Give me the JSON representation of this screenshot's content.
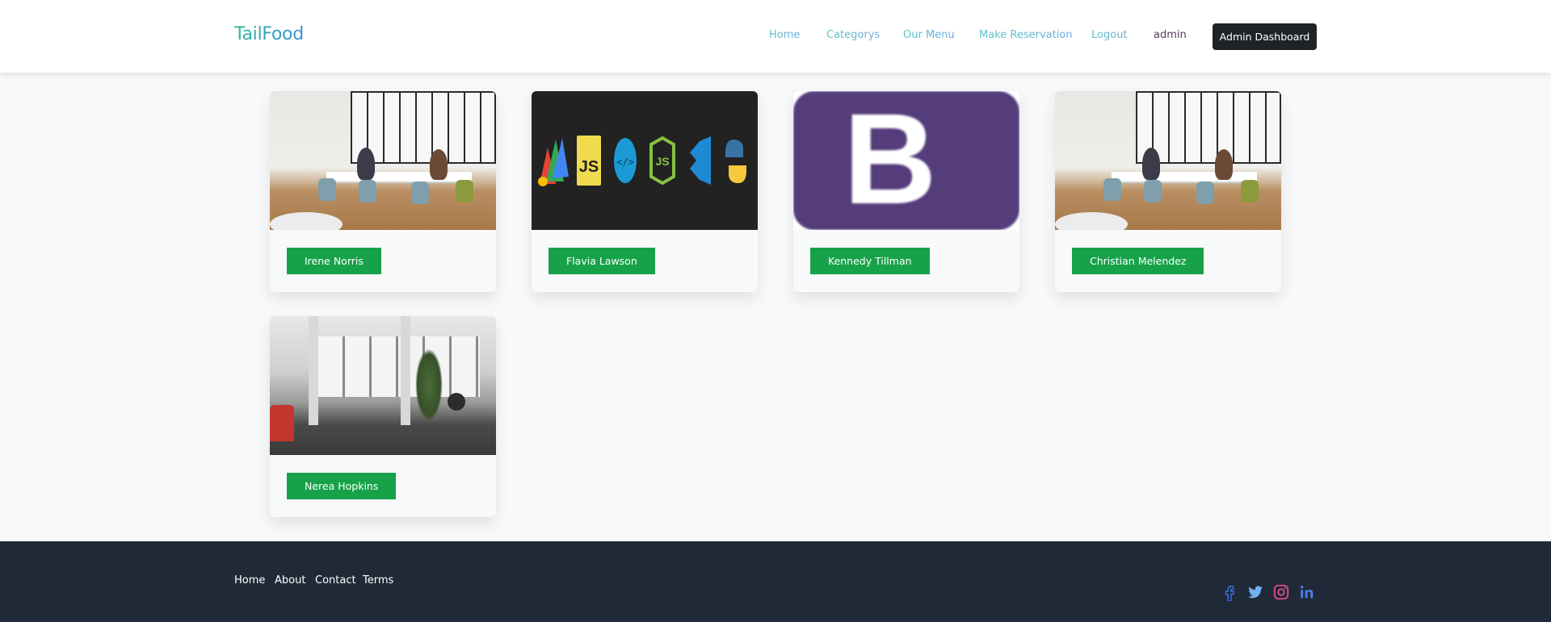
{
  "header": {
    "logo": "TailFood",
    "nav": [
      {
        "label": "Home"
      },
      {
        "label": "Categorys"
      },
      {
        "label": "Our Menu"
      },
      {
        "label": "Make Reservation"
      },
      {
        "label": "Logout"
      }
    ],
    "user": "admin",
    "dashboard_button": "Admin Dashboard"
  },
  "cards": [
    {
      "name": "Irene Norris",
      "image": "office-desk-photo"
    },
    {
      "name": "Flavia Lawson",
      "image": "code-icons-logo"
    },
    {
      "name": "Kennedy Tillman",
      "image": "bootstrap-logo"
    },
    {
      "name": "Christian Melendez",
      "image": "office-desk-photo"
    },
    {
      "name": "Nerea Hopkins",
      "image": "loft-office-photo"
    }
  ],
  "footer": {
    "links": [
      {
        "label": "Home"
      },
      {
        "label": "About"
      },
      {
        "label": "Contact"
      },
      {
        "label": "Terms"
      }
    ],
    "social": [
      "facebook-icon",
      "twitter-icon",
      "instagram-icon",
      "linkedin-icon"
    ]
  },
  "colors": {
    "header_bg": "#ffffff",
    "button_dark": "#1f2328",
    "tag_green": "#17a24a",
    "footer_bg": "#1f2937",
    "page_bg": "#f8f9fb"
  }
}
